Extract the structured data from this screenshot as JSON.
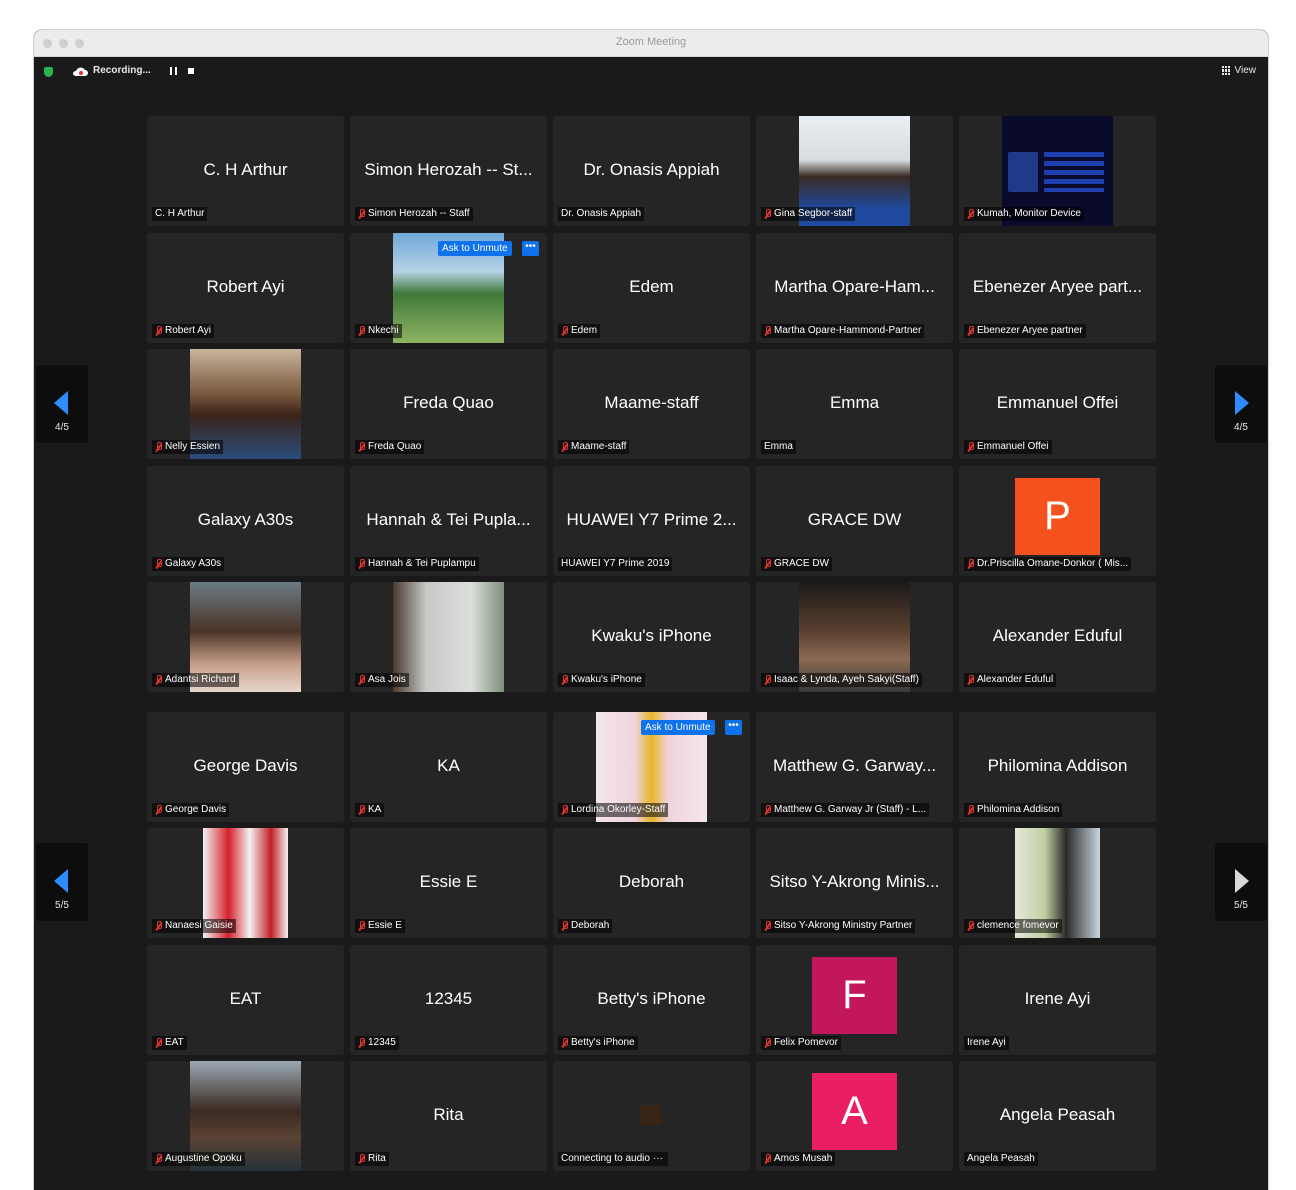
{
  "window": {
    "title": "Zoom Meeting",
    "recording_label": "Recording...",
    "view_label": "View"
  },
  "colors": {
    "accent": "#2d8cff",
    "unmute": "#0e72ed",
    "muted_mic": "#e0342c",
    "shield": "#2bb24c",
    "avatar_p": "#f4511e",
    "avatar_f": "#c2185b",
    "avatar_a": "#e91e63"
  },
  "unmute_pill": {
    "label": "Ask to Unmute",
    "more": "•••"
  },
  "page1": {
    "prev_label": "4/5",
    "next_label": "4/5",
    "tiles": [
      {
        "center": "C. H Arthur",
        "label": "C. H Arthur",
        "muted": false,
        "kind": "name"
      },
      {
        "center": "Simon Herozah -- St...",
        "label": "Simon Herozah -- Staff",
        "muted": true,
        "kind": "name"
      },
      {
        "center": "Dr. Onasis Appiah",
        "label": "Dr. Onasis Appiah",
        "muted": false,
        "kind": "name"
      },
      {
        "center": "",
        "label": "Gina Segbor-staff",
        "muted": true,
        "kind": "photo",
        "photo": "portrait-woman-smiling"
      },
      {
        "center": "",
        "label": "Kumah, Monitor Device",
        "muted": true,
        "kind": "photo",
        "photo": "organization-logo"
      },
      {
        "center": "Robert Ayi",
        "label": "Robert Ayi",
        "muted": true,
        "kind": "name"
      },
      {
        "center": "",
        "label": "Nkechi",
        "muted": true,
        "kind": "photo",
        "photo": "beach-palm-tree",
        "unmute": true
      },
      {
        "center": "Edem",
        "label": "Edem",
        "muted": true,
        "kind": "name"
      },
      {
        "center": "Martha Opare-Ham...",
        "label": "Martha Opare-Hammond-Partner",
        "muted": true,
        "kind": "name"
      },
      {
        "center": "Ebenezer Aryee part...",
        "label": "Ebenezer Aryee partner",
        "muted": true,
        "kind": "name"
      },
      {
        "center": "",
        "label": "Nelly Essien",
        "muted": true,
        "kind": "photo",
        "photo": "portrait-woman-outdoors"
      },
      {
        "center": "Freda Quao",
        "label": "Freda Quao",
        "muted": true,
        "kind": "name"
      },
      {
        "center": "Maame-staff",
        "label": "Maame-staff",
        "muted": true,
        "kind": "name"
      },
      {
        "center": "Emma",
        "label": "Emma",
        "muted": false,
        "kind": "name"
      },
      {
        "center": "Emmanuel Offei",
        "label": "Emmanuel Offei",
        "muted": true,
        "kind": "name"
      },
      {
        "center": "Galaxy A30s",
        "label": "Galaxy A30s",
        "muted": true,
        "kind": "name"
      },
      {
        "center": "Hannah & Tei Pupla...",
        "label": "Hannah & Tei Puplampu",
        "muted": true,
        "kind": "name"
      },
      {
        "center": "HUAWEI Y7 Prime 2...",
        "label": "HUAWEI Y7 Prime 2019",
        "muted": false,
        "kind": "name"
      },
      {
        "center": "GRACE DW",
        "label": "GRACE DW",
        "muted": true,
        "kind": "name"
      },
      {
        "center": "",
        "label": "Dr.Priscilla Omane-Donkor ( Mis...",
        "muted": true,
        "kind": "avatar",
        "letter": "P",
        "color": "#f4511e"
      },
      {
        "center": "",
        "label": "Adantsi Richard",
        "muted": true,
        "kind": "photo",
        "photo": "portrait-woman-glasses"
      },
      {
        "center": "",
        "label": "Asa Jois",
        "muted": true,
        "kind": "photo",
        "photo": "portrait-woman-white-dress"
      },
      {
        "center": "Kwaku's iPhone",
        "label": "Kwaku's iPhone",
        "muted": true,
        "kind": "name"
      },
      {
        "center": "",
        "label": "Isaac & Lynda, Ayeh Sakyi(Staff)",
        "muted": true,
        "kind": "photo",
        "photo": "portrait-woman-braids"
      },
      {
        "center": "Alexander Eduful",
        "label": "Alexander Eduful",
        "muted": true,
        "kind": "name"
      }
    ]
  },
  "page2": {
    "prev_label": "5/5",
    "next_label": "5/5",
    "tiles": [
      {
        "center": "George Davis",
        "label": "George Davis",
        "muted": true,
        "kind": "name"
      },
      {
        "center": "KA",
        "label": "KA",
        "muted": true,
        "kind": "name"
      },
      {
        "center": "",
        "label": "Lordina Okorley-Staff",
        "muted": true,
        "kind": "photo",
        "photo": "woman-yellow-dress",
        "unmute": true
      },
      {
        "center": "Matthew G. Garway...",
        "label": "Matthew G. Garway Jr (Staff) - L...",
        "muted": true,
        "kind": "name"
      },
      {
        "center": "Philomina Addison",
        "label": "Philomina Addison",
        "muted": true,
        "kind": "name"
      },
      {
        "center": "",
        "label": "Nanaesi Gaisie",
        "muted": true,
        "kind": "photo",
        "photo": "soda-bottles"
      },
      {
        "center": "Essie E",
        "label": "Essie E",
        "muted": true,
        "kind": "name"
      },
      {
        "center": "Deborah",
        "label": "Deborah",
        "muted": true,
        "kind": "name"
      },
      {
        "center": "Sitso Y-Akrong Minis...",
        "label": "Sitso Y-Akrong Ministry Partner",
        "muted": true,
        "kind": "name"
      },
      {
        "center": "",
        "label": "clemence fomevor",
        "muted": true,
        "kind": "photo",
        "photo": "man-with-flowers"
      },
      {
        "center": "EAT",
        "label": "EAT",
        "muted": true,
        "kind": "name"
      },
      {
        "center": "12345",
        "label": "12345",
        "muted": true,
        "kind": "name"
      },
      {
        "center": "Betty's iPhone",
        "label": "Betty's iPhone",
        "muted": true,
        "kind": "name"
      },
      {
        "center": "",
        "label": "Felix Pomevor",
        "muted": true,
        "kind": "avatar",
        "letter": "F",
        "color": "#c2185b"
      },
      {
        "center": "Irene Ayi",
        "label": "Irene Ayi",
        "muted": false,
        "kind": "name"
      },
      {
        "center": "",
        "label": "Augustine Opoku",
        "muted": true,
        "kind": "photo",
        "photo": "group-selfie"
      },
      {
        "center": "Rita",
        "label": "Rita",
        "muted": true,
        "kind": "name"
      },
      {
        "center": "",
        "label": "Connecting to audio",
        "muted": false,
        "kind": "connecting"
      },
      {
        "center": "",
        "label": "Amos Musah",
        "muted": true,
        "kind": "avatar",
        "letter": "A",
        "color": "#e91e63"
      },
      {
        "center": "Angela Peasah",
        "label": "Angela Peasah",
        "muted": false,
        "kind": "name"
      }
    ]
  }
}
